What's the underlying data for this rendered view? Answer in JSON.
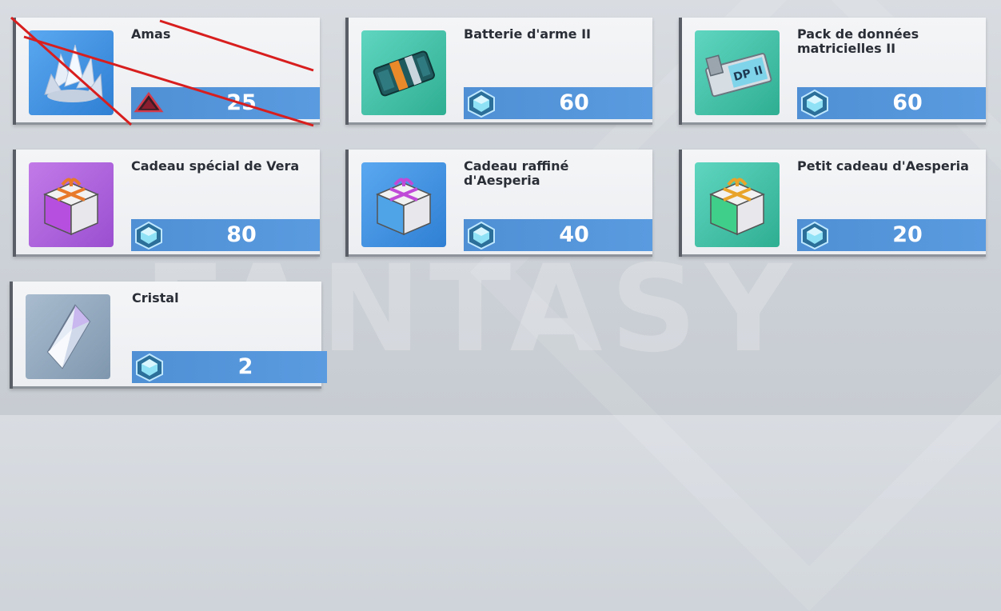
{
  "items": [
    {
      "name": "Amas",
      "price": "25",
      "icon": "crystal-cluster-icon",
      "currency_icon": "red-triangle-currency-icon",
      "thumb_color": "#3a8fe0"
    },
    {
      "name": "Batterie d'arme II",
      "price": "60",
      "icon": "weapon-battery-icon",
      "currency_icon": "dark-crystal-currency-icon",
      "thumb_color": "#3cbfa4"
    },
    {
      "name": "Pack de données matricielles II",
      "price": "60",
      "icon": "matrix-data-pack-icon",
      "currency_icon": "dark-crystal-currency-icon",
      "thumb_color": "#3cbfa4"
    },
    {
      "name": "Cadeau spécial de Vera",
      "price": "80",
      "icon": "special-gift-box-icon",
      "currency_icon": "dark-crystal-currency-icon",
      "thumb_color": "#a95fd6"
    },
    {
      "name": "Cadeau raffiné d'Aesperia",
      "price": "40",
      "icon": "refined-gift-box-icon",
      "currency_icon": "dark-crystal-currency-icon",
      "thumb_color": "#3a8fe0"
    },
    {
      "name": "Petit cadeau d'Aesperia",
      "price": "20",
      "icon": "small-gift-box-icon",
      "currency_icon": "dark-crystal-currency-icon",
      "thumb_color": "#3cbfa4"
    },
    {
      "name": "Cristal",
      "price": "2",
      "icon": "crystal-icon",
      "currency_icon": "dark-crystal-currency-icon",
      "thumb_color": "#8ea6bd"
    }
  ],
  "background_text": "FANTASY",
  "colors": {
    "price_bar": "#5a9be0",
    "strike_line": "#d81e1e",
    "card_bg": "#f0f1f4"
  }
}
